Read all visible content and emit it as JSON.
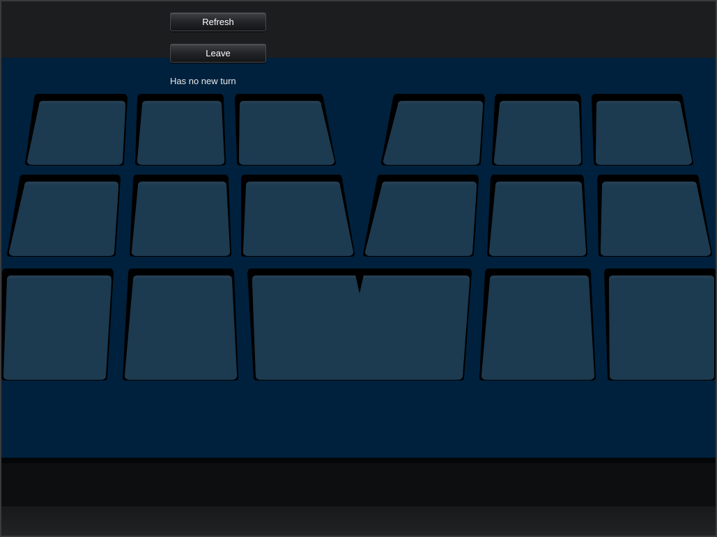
{
  "controls": {
    "refresh_label": "Refresh",
    "leave_label": "Leave"
  },
  "status": {
    "turn_text": "Has no new turn"
  },
  "board": {
    "rows": [
      {
        "name": "row-1",
        "slot_count": 6
      },
      {
        "name": "row-2",
        "slot_count": 6
      },
      {
        "name": "row-3",
        "slot_count": 5
      }
    ],
    "colors": {
      "board_background": "#00213d",
      "slot_fill": "#1c3a50",
      "slot_rim": "#000000",
      "slot_inner_edge": "#243f53"
    }
  }
}
